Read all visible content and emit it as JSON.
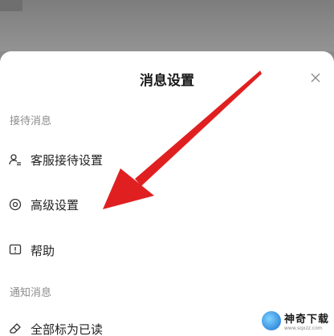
{
  "sheet": {
    "title": "消息设置",
    "close_icon": "close-icon"
  },
  "sections": [
    {
      "label": "接待消息",
      "items": [
        {
          "label": "客服接待设置",
          "icon": "user-settings-icon"
        },
        {
          "label": "高级设置",
          "icon": "target-icon"
        },
        {
          "label": "帮助",
          "icon": "help-icon"
        }
      ]
    },
    {
      "label": "通知消息",
      "items": [
        {
          "label": "全部标为已读",
          "icon": "eraser-icon"
        }
      ]
    }
  ],
  "annotation": {
    "color": "#e02020"
  },
  "watermark": {
    "name": "神奇下载",
    "url": "www.sqxzz.com"
  }
}
